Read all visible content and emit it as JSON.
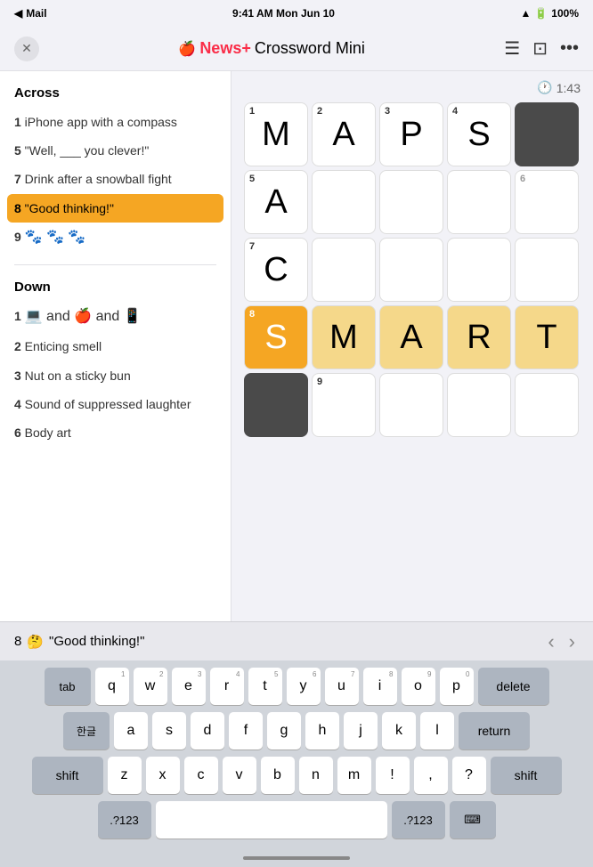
{
  "statusBar": {
    "carrier": "Mail",
    "time": "9:41 AM",
    "date": "Mon Jun 10",
    "wifi": "WiFi",
    "battery": "100%"
  },
  "header": {
    "title": "Crossword Mini",
    "newsPlus": "News+",
    "appleIcon": "",
    "listIconLabel": "list-icon",
    "screenIconLabel": "screen-icon",
    "moreIconLabel": "more-icon"
  },
  "timer": {
    "icon": "🕐",
    "value": "1:43"
  },
  "clues": {
    "acrossTitle": "Across",
    "acrossItems": [
      {
        "number": "1",
        "text": "iPhone app with a compass"
      },
      {
        "number": "5",
        "text": "\"Well, ___ you clever!\""
      },
      {
        "number": "7",
        "text": "Drink after a snowball fight"
      },
      {
        "number": "8",
        "text": "\"Good thinking!\"",
        "active": true
      },
      {
        "number": "9",
        "text": "🐾 🐾 🐾"
      }
    ],
    "downTitle": "Down",
    "downItems": [
      {
        "number": "1",
        "text": "💻 and 🍎 and 📱"
      },
      {
        "number": "2",
        "text": "Enticing smell"
      },
      {
        "number": "3",
        "text": "Nut on a sticky bun"
      },
      {
        "number": "4",
        "text": "Sound of suppressed laughter"
      },
      {
        "number": "6",
        "text": "Body art"
      }
    ]
  },
  "grid": {
    "cells": [
      {
        "row": 0,
        "col": 0,
        "letter": "M",
        "number": "1",
        "type": "normal"
      },
      {
        "row": 0,
        "col": 1,
        "letter": "A",
        "number": "2",
        "type": "normal"
      },
      {
        "row": 0,
        "col": 2,
        "letter": "P",
        "number": "3",
        "type": "normal"
      },
      {
        "row": 0,
        "col": 3,
        "letter": "S",
        "number": "4",
        "type": "normal"
      },
      {
        "row": 0,
        "col": 4,
        "letter": "",
        "number": "",
        "type": "black"
      },
      {
        "row": 1,
        "col": 0,
        "letter": "A",
        "number": "5",
        "type": "normal"
      },
      {
        "row": 1,
        "col": 1,
        "letter": "",
        "number": "",
        "type": "normal"
      },
      {
        "row": 1,
        "col": 2,
        "letter": "",
        "number": "",
        "type": "normal"
      },
      {
        "row": 1,
        "col": 3,
        "letter": "",
        "number": "",
        "type": "normal"
      },
      {
        "row": 1,
        "col": 4,
        "letter": "",
        "number": "6",
        "type": "normal"
      },
      {
        "row": 2,
        "col": 0,
        "letter": "C",
        "number": "7",
        "type": "normal"
      },
      {
        "row": 2,
        "col": 1,
        "letter": "",
        "number": "",
        "type": "normal"
      },
      {
        "row": 2,
        "col": 2,
        "letter": "",
        "number": "",
        "type": "normal"
      },
      {
        "row": 2,
        "col": 3,
        "letter": "",
        "number": "",
        "type": "normal"
      },
      {
        "row": 2,
        "col": 4,
        "letter": "",
        "number": "",
        "type": "normal"
      },
      {
        "row": 3,
        "col": 0,
        "letter": "S",
        "number": "8",
        "type": "active"
      },
      {
        "row": 3,
        "col": 1,
        "letter": "M",
        "number": "",
        "type": "highlighted"
      },
      {
        "row": 3,
        "col": 2,
        "letter": "A",
        "number": "",
        "type": "highlighted"
      },
      {
        "row": 3,
        "col": 3,
        "letter": "R",
        "number": "",
        "type": "highlighted"
      },
      {
        "row": 3,
        "col": 4,
        "letter": "T",
        "number": "",
        "type": "highlighted"
      },
      {
        "row": 4,
        "col": 0,
        "letter": "",
        "number": "",
        "type": "black"
      },
      {
        "row": 4,
        "col": 1,
        "letter": "",
        "number": "9",
        "type": "normal"
      },
      {
        "row": 4,
        "col": 2,
        "letter": "",
        "number": "",
        "type": "normal"
      },
      {
        "row": 4,
        "col": 3,
        "letter": "",
        "number": "",
        "type": "normal"
      },
      {
        "row": 4,
        "col": 4,
        "letter": "",
        "number": "",
        "type": "normal"
      }
    ]
  },
  "bottomClue": {
    "number": "8",
    "emoji": "🤔",
    "text": "\"Good thinking!\""
  },
  "keyboard": {
    "rows": [
      [
        "tab",
        "q",
        "w",
        "e",
        "r",
        "t",
        "y",
        "u",
        "i",
        "o",
        "p",
        "delete"
      ],
      [
        "한글",
        "a",
        "s",
        "d",
        "f",
        "g",
        "h",
        "j",
        "k",
        "l",
        "return"
      ],
      [
        "shift",
        "z",
        "x",
        "c",
        "v",
        "b",
        "n",
        "m",
        "!",
        ",",
        "?",
        "shift"
      ],
      [
        ".?123",
        "",
        "",
        ".?123",
        "⌨"
      ]
    ],
    "row1": [
      "tab",
      "q",
      "w",
      "e",
      "r",
      "t",
      "y",
      "u",
      "i",
      "o",
      "p",
      "delete"
    ],
    "row2": [
      "한글",
      "a",
      "s",
      "d",
      "f",
      "g",
      "h",
      "j",
      "k",
      "l",
      "return"
    ],
    "row3": [
      "shift",
      "z",
      "x",
      "c",
      "v",
      "b",
      "n",
      "m",
      "!",
      ",",
      "?",
      "shift"
    ],
    "subs": {
      "q": "1",
      "w": "2",
      "e": "3",
      "r": "4",
      "t": "5",
      "y": "6",
      "u": "7",
      "i": "8",
      "o": "9",
      "p": "0",
      "a": "",
      "s": "",
      "d": "",
      "f": "",
      "g": "",
      "h": "",
      "j": "",
      "k": "",
      "l": "",
      "z": "",
      "x": "",
      "c": "",
      "v": "",
      "b": "",
      "n": "",
      "m": "",
      "!": "!",
      ",": "??"
    }
  }
}
